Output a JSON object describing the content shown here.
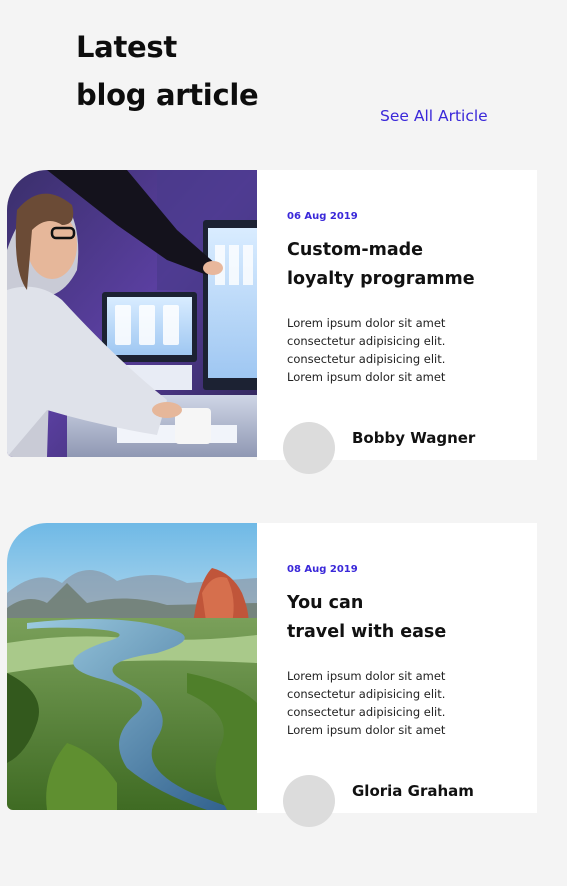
{
  "header": {
    "title_line1": "Latest",
    "title_line2": "blog article",
    "see_all_label": "See All Article"
  },
  "articles": [
    {
      "image": "woman-at-computer-photo",
      "date": "06 Aug 2019",
      "title_line1": "Custom-made",
      "title_line2": "loyalty programme",
      "excerpt": [
        "Lorem ipsum dolor sit amet",
        "consectetur adipisicing elit.",
        "consectetur adipisicing elit.",
        "Lorem ipsum dolor sit amet"
      ],
      "author": "Bobby Wagner"
    },
    {
      "image": "river-landscape-photo",
      "date": "08 Aug 2019",
      "title_line1": "You can",
      "title_line2": "travel with ease",
      "excerpt": [
        "Lorem ipsum dolor sit amet",
        "consectetur adipisicing elit.",
        "consectetur adipisicing elit.",
        "Lorem ipsum dolor sit amet"
      ],
      "author": "Gloria Graham"
    }
  ],
  "colors": {
    "background": "#f4f4f4",
    "accent": "#3a28d9",
    "card_background": "#ffffff",
    "avatar_placeholder": "#dcdcdc"
  }
}
